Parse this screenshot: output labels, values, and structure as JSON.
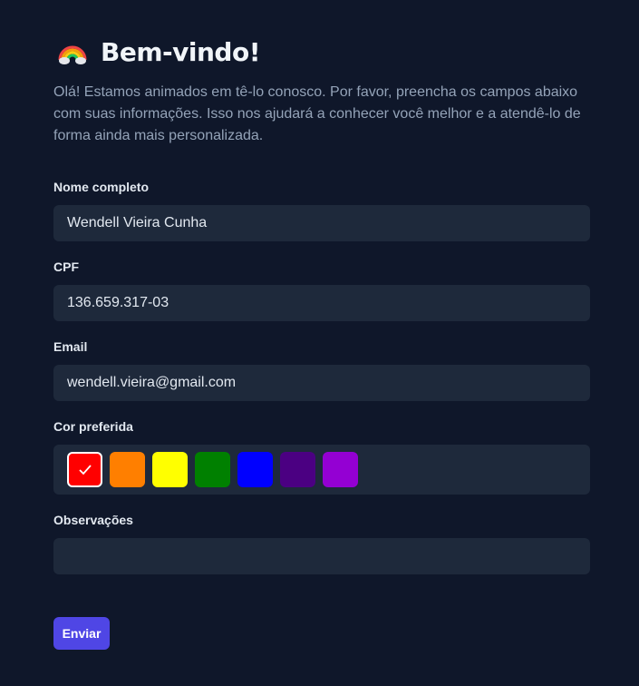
{
  "header": {
    "icon": "rainbow-icon",
    "title": "Bem-vindo!"
  },
  "intro": "Olá! Estamos animados em tê-lo conosco. Por favor, preencha os campos abaixo com suas informações. Isso nos ajudará a conhecer você melhor e a atendê-lo de forma ainda mais personalizada.",
  "form": {
    "name": {
      "label": "Nome completo",
      "value": "Wendell Vieira Cunha"
    },
    "cpf": {
      "label": "CPF",
      "value": "136.659.317-03"
    },
    "email": {
      "label": "Email",
      "value": "wendell.vieira@gmail.com"
    },
    "color": {
      "label": "Cor preferida",
      "options": [
        "#ff0000",
        "#ff7f00",
        "#ffff00",
        "#008000",
        "#0000ff",
        "#4b0082",
        "#9400d3"
      ],
      "selected_index": 0
    },
    "notes": {
      "label": "Observações",
      "value": ""
    },
    "submit_label": "Enviar"
  },
  "colors": {
    "background": "#0f172a",
    "input_bg": "#1e293b",
    "accent": "#4f46e5",
    "muted_text": "#94a3b8"
  }
}
